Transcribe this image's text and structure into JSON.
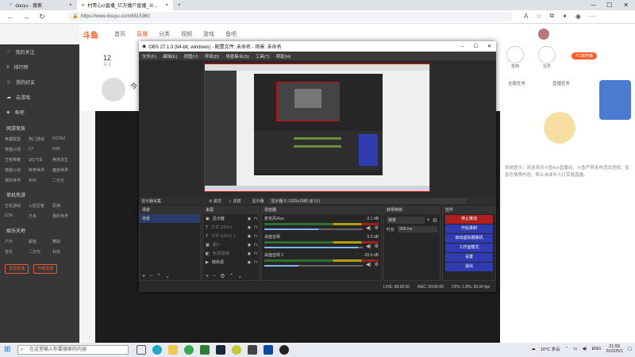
{
  "browser": {
    "tabs": [
      {
        "label": "douyu - 搜索"
      },
      {
        "label": "村哥心ct直播_亿万播户直播_斗..."
      }
    ],
    "new_tab": "+",
    "url": "https://www.douyu.com/6515360"
  },
  "site": {
    "logo": "斗鱼",
    "nav": [
      "首页",
      "直播",
      "分类",
      "视频",
      "游戏",
      "鱼吧"
    ],
    "nav_active": "直播",
    "sidebar_top": [
      "我的关注",
      "排行榜",
      "我的好友",
      "云游戏",
      "鱼吧"
    ],
    "sidebar_sections": [
      {
        "head": "网游竞技",
        "items": [
          "英雄联盟",
          "热门游戏",
          "DOTA2",
          "穿越火线",
          "CF",
          "DNF",
          "王者荣耀",
          "QQ飞车",
          "绝地求生",
          "穿越火线",
          "传奇世界",
          "魔兽世界",
          "我的世界",
          "炉石",
          "二次元"
        ]
      },
      {
        "head": "单机热游",
        "items": [
          "主机游戏",
          "火影忍者",
          "原神",
          "GTA",
          "方舟",
          "我的世界"
        ]
      },
      {
        "head": "娱乐天地",
        "items": [
          "户外",
          "颜值",
          "舞蹈",
          "音乐",
          "二次元",
          "科技"
        ]
      }
    ],
    "sidebar_buttons": [
      "发现直播",
      "开播直播"
    ],
    "room_stat": "12",
    "room_stat_label": "关注",
    "room_title": "今",
    "right_panel": {
      "badge": "PC端开播",
      "icons": [
        "签到",
        "任务",
        "活动",
        "宝箱"
      ],
      "links": [
        "全服任务",
        "直播任务"
      ],
      "notice": "系统提示：欢迎来到斗鱼live直播间，斗鱼严禁发布违法违规、低俗色情等内容，禁止未成年人打赏或直播。"
    }
  },
  "obs": {
    "title": "OBS 27.1.3 (64-bit, windows) - 配置文件: 未命名 - 场景: 未命名",
    "menu": [
      "文件(F)",
      "编辑(E)",
      "视图(V)",
      "停靠(D)",
      "场景集合(S)",
      "工具(T)",
      "帮助(H)"
    ],
    "info_left": "显示器采集",
    "info_props": "属性",
    "info_filters": "滤镜",
    "info_display": "显示器",
    "info_resolution": "显示器 0: 1920x1080 @ 0,0",
    "docks": {
      "scenes": {
        "title": "场景",
        "items": [
          "场景"
        ]
      },
      "sources": {
        "title": "来源",
        "items": [
          "显示器",
          "文本 (GDI+)",
          "文本 (GDI+) 2",
          "图片",
          "色源/图像",
          "媒体源"
        ]
      },
      "mixer": {
        "title": "混音器",
        "channels": [
          {
            "name": "麦克风/Aux",
            "db": "-3.1 dB",
            "level": 0.55
          },
          {
            "name": "桌面音频",
            "db": "0.0 dB",
            "level": 0.95
          },
          {
            "name": "桌面音频 2",
            "db": "-20.6 dB",
            "level": 0.35
          }
        ]
      },
      "transitions": {
        "title": "转场特效",
        "type": "渐变",
        "duration_label": "时长",
        "duration": "300 ms"
      },
      "controls": {
        "title": "控件",
        "buttons": [
          "停止推流",
          "开始录制",
          "启动虚拟摄像机",
          "工作室模式",
          "设置",
          "退出"
        ]
      }
    },
    "status": {
      "live": "LIVE: 00:00:00",
      "rec": "REC: 00:00:00",
      "cpu": "CPU: 1.8%, 30.04 fps"
    }
  },
  "taskbar": {
    "search_placeholder": "在这里输入你要搜索的内容",
    "weather": "10°C 多云",
    "lang": "ENG",
    "time": "21:59",
    "date": "2022/5/1"
  }
}
